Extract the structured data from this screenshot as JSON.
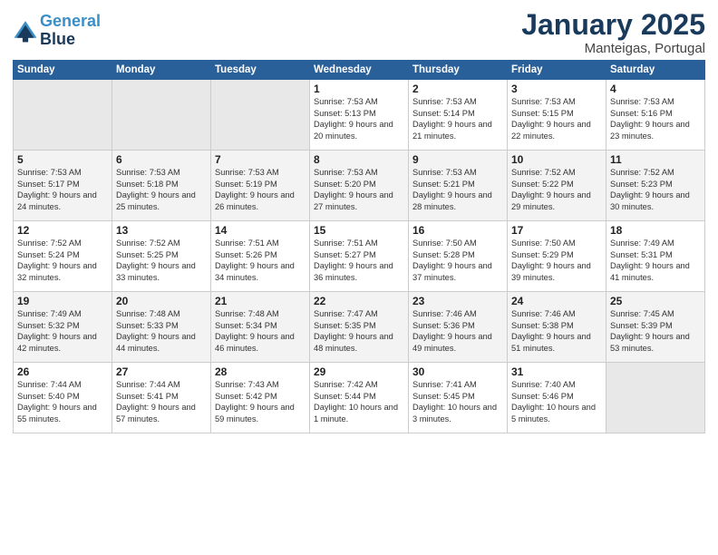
{
  "header": {
    "logo_line1": "General",
    "logo_line2": "Blue",
    "month": "January 2025",
    "location": "Manteigas, Portugal"
  },
  "weekdays": [
    "Sunday",
    "Monday",
    "Tuesday",
    "Wednesday",
    "Thursday",
    "Friday",
    "Saturday"
  ],
  "weeks": [
    [
      {
        "day": "",
        "sunrise": "",
        "sunset": "",
        "daylight": ""
      },
      {
        "day": "",
        "sunrise": "",
        "sunset": "",
        "daylight": ""
      },
      {
        "day": "",
        "sunrise": "",
        "sunset": "",
        "daylight": ""
      },
      {
        "day": "1",
        "sunrise": "Sunrise: 7:53 AM",
        "sunset": "Sunset: 5:13 PM",
        "daylight": "Daylight: 9 hours and 20 minutes."
      },
      {
        "day": "2",
        "sunrise": "Sunrise: 7:53 AM",
        "sunset": "Sunset: 5:14 PM",
        "daylight": "Daylight: 9 hours and 21 minutes."
      },
      {
        "day": "3",
        "sunrise": "Sunrise: 7:53 AM",
        "sunset": "Sunset: 5:15 PM",
        "daylight": "Daylight: 9 hours and 22 minutes."
      },
      {
        "day": "4",
        "sunrise": "Sunrise: 7:53 AM",
        "sunset": "Sunset: 5:16 PM",
        "daylight": "Daylight: 9 hours and 23 minutes."
      }
    ],
    [
      {
        "day": "5",
        "sunrise": "Sunrise: 7:53 AM",
        "sunset": "Sunset: 5:17 PM",
        "daylight": "Daylight: 9 hours and 24 minutes."
      },
      {
        "day": "6",
        "sunrise": "Sunrise: 7:53 AM",
        "sunset": "Sunset: 5:18 PM",
        "daylight": "Daylight: 9 hours and 25 minutes."
      },
      {
        "day": "7",
        "sunrise": "Sunrise: 7:53 AM",
        "sunset": "Sunset: 5:19 PM",
        "daylight": "Daylight: 9 hours and 26 minutes."
      },
      {
        "day": "8",
        "sunrise": "Sunrise: 7:53 AM",
        "sunset": "Sunset: 5:20 PM",
        "daylight": "Daylight: 9 hours and 27 minutes."
      },
      {
        "day": "9",
        "sunrise": "Sunrise: 7:53 AM",
        "sunset": "Sunset: 5:21 PM",
        "daylight": "Daylight: 9 hours and 28 minutes."
      },
      {
        "day": "10",
        "sunrise": "Sunrise: 7:52 AM",
        "sunset": "Sunset: 5:22 PM",
        "daylight": "Daylight: 9 hours and 29 minutes."
      },
      {
        "day": "11",
        "sunrise": "Sunrise: 7:52 AM",
        "sunset": "Sunset: 5:23 PM",
        "daylight": "Daylight: 9 hours and 30 minutes."
      }
    ],
    [
      {
        "day": "12",
        "sunrise": "Sunrise: 7:52 AM",
        "sunset": "Sunset: 5:24 PM",
        "daylight": "Daylight: 9 hours and 32 minutes."
      },
      {
        "day": "13",
        "sunrise": "Sunrise: 7:52 AM",
        "sunset": "Sunset: 5:25 PM",
        "daylight": "Daylight: 9 hours and 33 minutes."
      },
      {
        "day": "14",
        "sunrise": "Sunrise: 7:51 AM",
        "sunset": "Sunset: 5:26 PM",
        "daylight": "Daylight: 9 hours and 34 minutes."
      },
      {
        "day": "15",
        "sunrise": "Sunrise: 7:51 AM",
        "sunset": "Sunset: 5:27 PM",
        "daylight": "Daylight: 9 hours and 36 minutes."
      },
      {
        "day": "16",
        "sunrise": "Sunrise: 7:50 AM",
        "sunset": "Sunset: 5:28 PM",
        "daylight": "Daylight: 9 hours and 37 minutes."
      },
      {
        "day": "17",
        "sunrise": "Sunrise: 7:50 AM",
        "sunset": "Sunset: 5:29 PM",
        "daylight": "Daylight: 9 hours and 39 minutes."
      },
      {
        "day": "18",
        "sunrise": "Sunrise: 7:49 AM",
        "sunset": "Sunset: 5:31 PM",
        "daylight": "Daylight: 9 hours and 41 minutes."
      }
    ],
    [
      {
        "day": "19",
        "sunrise": "Sunrise: 7:49 AM",
        "sunset": "Sunset: 5:32 PM",
        "daylight": "Daylight: 9 hours and 42 minutes."
      },
      {
        "day": "20",
        "sunrise": "Sunrise: 7:48 AM",
        "sunset": "Sunset: 5:33 PM",
        "daylight": "Daylight: 9 hours and 44 minutes."
      },
      {
        "day": "21",
        "sunrise": "Sunrise: 7:48 AM",
        "sunset": "Sunset: 5:34 PM",
        "daylight": "Daylight: 9 hours and 46 minutes."
      },
      {
        "day": "22",
        "sunrise": "Sunrise: 7:47 AM",
        "sunset": "Sunset: 5:35 PM",
        "daylight": "Daylight: 9 hours and 48 minutes."
      },
      {
        "day": "23",
        "sunrise": "Sunrise: 7:46 AM",
        "sunset": "Sunset: 5:36 PM",
        "daylight": "Daylight: 9 hours and 49 minutes."
      },
      {
        "day": "24",
        "sunrise": "Sunrise: 7:46 AM",
        "sunset": "Sunset: 5:38 PM",
        "daylight": "Daylight: 9 hours and 51 minutes."
      },
      {
        "day": "25",
        "sunrise": "Sunrise: 7:45 AM",
        "sunset": "Sunset: 5:39 PM",
        "daylight": "Daylight: 9 hours and 53 minutes."
      }
    ],
    [
      {
        "day": "26",
        "sunrise": "Sunrise: 7:44 AM",
        "sunset": "Sunset: 5:40 PM",
        "daylight": "Daylight: 9 hours and 55 minutes."
      },
      {
        "day": "27",
        "sunrise": "Sunrise: 7:44 AM",
        "sunset": "Sunset: 5:41 PM",
        "daylight": "Daylight: 9 hours and 57 minutes."
      },
      {
        "day": "28",
        "sunrise": "Sunrise: 7:43 AM",
        "sunset": "Sunset: 5:42 PM",
        "daylight": "Daylight: 9 hours and 59 minutes."
      },
      {
        "day": "29",
        "sunrise": "Sunrise: 7:42 AM",
        "sunset": "Sunset: 5:44 PM",
        "daylight": "Daylight: 10 hours and 1 minute."
      },
      {
        "day": "30",
        "sunrise": "Sunrise: 7:41 AM",
        "sunset": "Sunset: 5:45 PM",
        "daylight": "Daylight: 10 hours and 3 minutes."
      },
      {
        "day": "31",
        "sunrise": "Sunrise: 7:40 AM",
        "sunset": "Sunset: 5:46 PM",
        "daylight": "Daylight: 10 hours and 5 minutes."
      },
      {
        "day": "",
        "sunrise": "",
        "sunset": "",
        "daylight": ""
      }
    ]
  ]
}
